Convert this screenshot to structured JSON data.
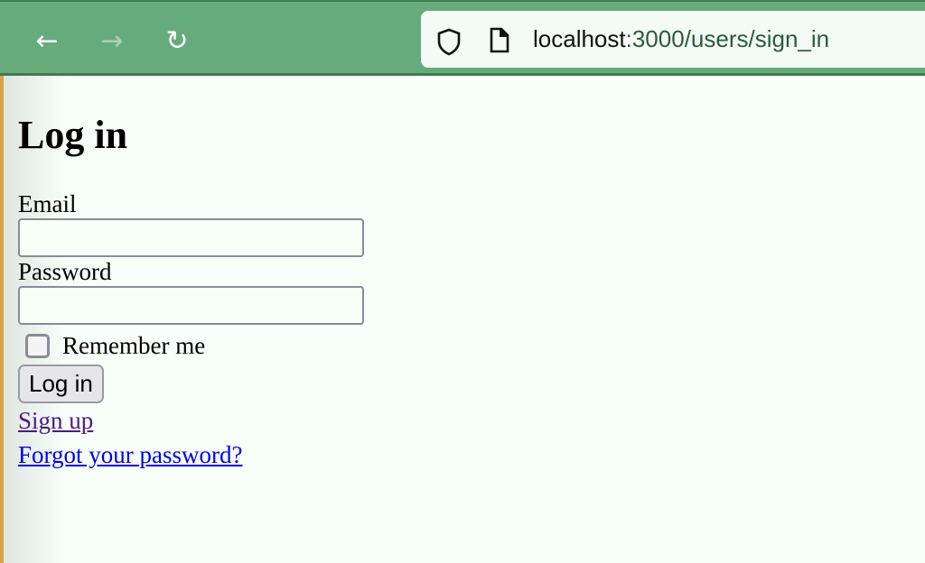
{
  "browser": {
    "url_host": "localhost",
    "url_path": ":3000/users/sign_in"
  },
  "page": {
    "title": "Log in",
    "email_label": "Email",
    "email_value": "",
    "password_label": "Password",
    "password_value": "",
    "remember_label": "Remember me",
    "remember_checked": false,
    "submit_label": "Log in",
    "signup_link": "Sign up",
    "forgot_link": "Forgot your password?"
  }
}
